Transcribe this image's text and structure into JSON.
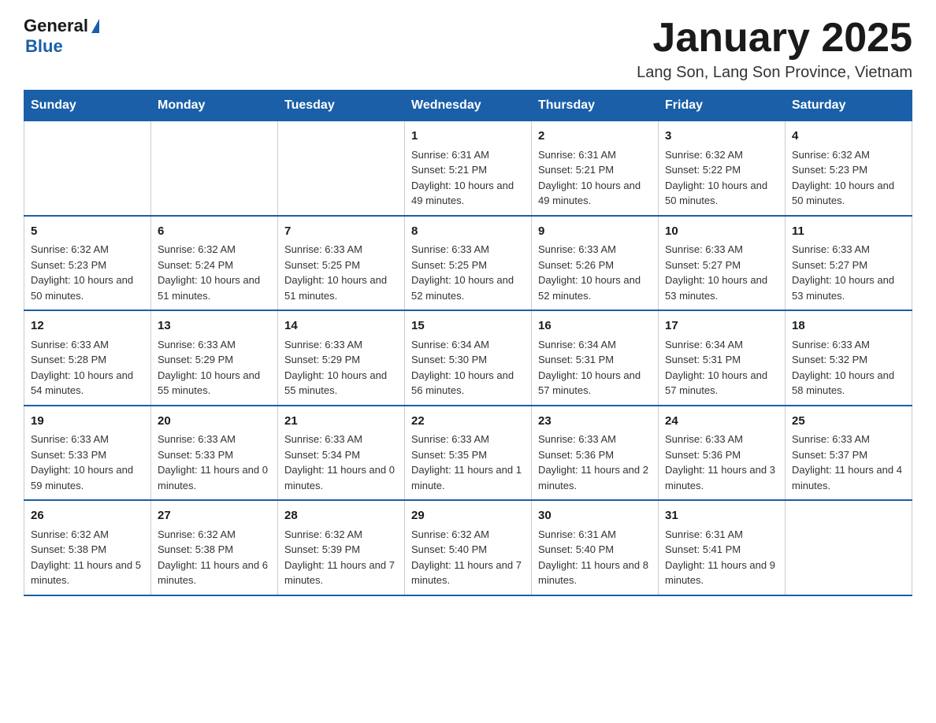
{
  "header": {
    "logo_general": "General",
    "logo_blue": "Blue",
    "title": "January 2025",
    "subtitle": "Lang Son, Lang Son Province, Vietnam"
  },
  "days_of_week": [
    "Sunday",
    "Monday",
    "Tuesday",
    "Wednesday",
    "Thursday",
    "Friday",
    "Saturday"
  ],
  "weeks": [
    [
      {
        "day": "",
        "info": ""
      },
      {
        "day": "",
        "info": ""
      },
      {
        "day": "",
        "info": ""
      },
      {
        "day": "1",
        "info": "Sunrise: 6:31 AM\nSunset: 5:21 PM\nDaylight: 10 hours and 49 minutes."
      },
      {
        "day": "2",
        "info": "Sunrise: 6:31 AM\nSunset: 5:21 PM\nDaylight: 10 hours and 49 minutes."
      },
      {
        "day": "3",
        "info": "Sunrise: 6:32 AM\nSunset: 5:22 PM\nDaylight: 10 hours and 50 minutes."
      },
      {
        "day": "4",
        "info": "Sunrise: 6:32 AM\nSunset: 5:23 PM\nDaylight: 10 hours and 50 minutes."
      }
    ],
    [
      {
        "day": "5",
        "info": "Sunrise: 6:32 AM\nSunset: 5:23 PM\nDaylight: 10 hours and 50 minutes."
      },
      {
        "day": "6",
        "info": "Sunrise: 6:32 AM\nSunset: 5:24 PM\nDaylight: 10 hours and 51 minutes."
      },
      {
        "day": "7",
        "info": "Sunrise: 6:33 AM\nSunset: 5:25 PM\nDaylight: 10 hours and 51 minutes."
      },
      {
        "day": "8",
        "info": "Sunrise: 6:33 AM\nSunset: 5:25 PM\nDaylight: 10 hours and 52 minutes."
      },
      {
        "day": "9",
        "info": "Sunrise: 6:33 AM\nSunset: 5:26 PM\nDaylight: 10 hours and 52 minutes."
      },
      {
        "day": "10",
        "info": "Sunrise: 6:33 AM\nSunset: 5:27 PM\nDaylight: 10 hours and 53 minutes."
      },
      {
        "day": "11",
        "info": "Sunrise: 6:33 AM\nSunset: 5:27 PM\nDaylight: 10 hours and 53 minutes."
      }
    ],
    [
      {
        "day": "12",
        "info": "Sunrise: 6:33 AM\nSunset: 5:28 PM\nDaylight: 10 hours and 54 minutes."
      },
      {
        "day": "13",
        "info": "Sunrise: 6:33 AM\nSunset: 5:29 PM\nDaylight: 10 hours and 55 minutes."
      },
      {
        "day": "14",
        "info": "Sunrise: 6:33 AM\nSunset: 5:29 PM\nDaylight: 10 hours and 55 minutes."
      },
      {
        "day": "15",
        "info": "Sunrise: 6:34 AM\nSunset: 5:30 PM\nDaylight: 10 hours and 56 minutes."
      },
      {
        "day": "16",
        "info": "Sunrise: 6:34 AM\nSunset: 5:31 PM\nDaylight: 10 hours and 57 minutes."
      },
      {
        "day": "17",
        "info": "Sunrise: 6:34 AM\nSunset: 5:31 PM\nDaylight: 10 hours and 57 minutes."
      },
      {
        "day": "18",
        "info": "Sunrise: 6:33 AM\nSunset: 5:32 PM\nDaylight: 10 hours and 58 minutes."
      }
    ],
    [
      {
        "day": "19",
        "info": "Sunrise: 6:33 AM\nSunset: 5:33 PM\nDaylight: 10 hours and 59 minutes."
      },
      {
        "day": "20",
        "info": "Sunrise: 6:33 AM\nSunset: 5:33 PM\nDaylight: 11 hours and 0 minutes."
      },
      {
        "day": "21",
        "info": "Sunrise: 6:33 AM\nSunset: 5:34 PM\nDaylight: 11 hours and 0 minutes."
      },
      {
        "day": "22",
        "info": "Sunrise: 6:33 AM\nSunset: 5:35 PM\nDaylight: 11 hours and 1 minute."
      },
      {
        "day": "23",
        "info": "Sunrise: 6:33 AM\nSunset: 5:36 PM\nDaylight: 11 hours and 2 minutes."
      },
      {
        "day": "24",
        "info": "Sunrise: 6:33 AM\nSunset: 5:36 PM\nDaylight: 11 hours and 3 minutes."
      },
      {
        "day": "25",
        "info": "Sunrise: 6:33 AM\nSunset: 5:37 PM\nDaylight: 11 hours and 4 minutes."
      }
    ],
    [
      {
        "day": "26",
        "info": "Sunrise: 6:32 AM\nSunset: 5:38 PM\nDaylight: 11 hours and 5 minutes."
      },
      {
        "day": "27",
        "info": "Sunrise: 6:32 AM\nSunset: 5:38 PM\nDaylight: 11 hours and 6 minutes."
      },
      {
        "day": "28",
        "info": "Sunrise: 6:32 AM\nSunset: 5:39 PM\nDaylight: 11 hours and 7 minutes."
      },
      {
        "day": "29",
        "info": "Sunrise: 6:32 AM\nSunset: 5:40 PM\nDaylight: 11 hours and 7 minutes."
      },
      {
        "day": "30",
        "info": "Sunrise: 6:31 AM\nSunset: 5:40 PM\nDaylight: 11 hours and 8 minutes."
      },
      {
        "day": "31",
        "info": "Sunrise: 6:31 AM\nSunset: 5:41 PM\nDaylight: 11 hours and 9 minutes."
      },
      {
        "day": "",
        "info": ""
      }
    ]
  ]
}
